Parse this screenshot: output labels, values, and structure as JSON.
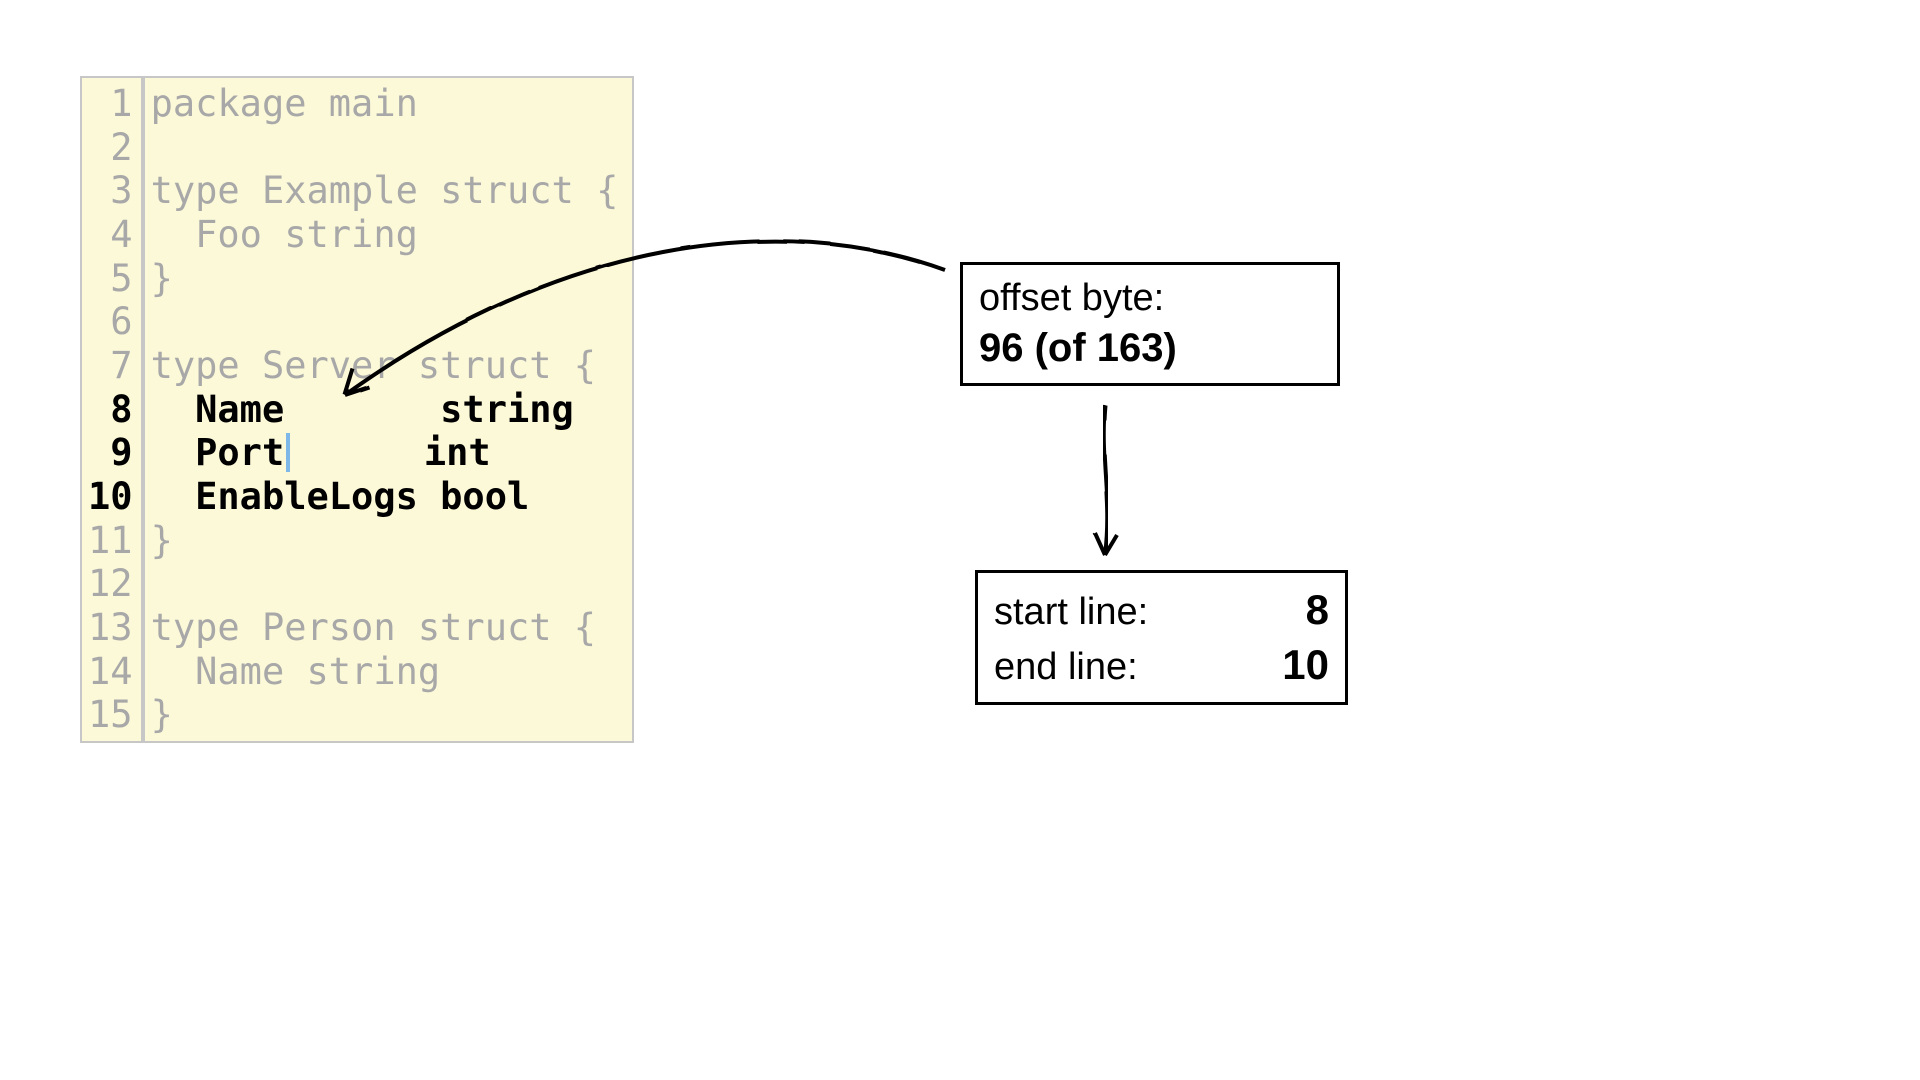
{
  "editor": {
    "bold_lines": [
      8,
      9,
      10
    ],
    "cursor": {
      "line": 9,
      "after_text": "  Port"
    },
    "lines": [
      {
        "n": 1,
        "text": "package main",
        "bold": false
      },
      {
        "n": 2,
        "text": "",
        "bold": false
      },
      {
        "n": 3,
        "text": "type Example struct {",
        "bold": false
      },
      {
        "n": 4,
        "text": "  Foo string",
        "bold": false
      },
      {
        "n": 5,
        "text": "}",
        "bold": false
      },
      {
        "n": 6,
        "text": "",
        "bold": false
      },
      {
        "n": 7,
        "text": "type Server struct {",
        "bold": false
      },
      {
        "n": 8,
        "text": "  Name       string",
        "bold": true
      },
      {
        "n": 9,
        "text": "  Port       int",
        "bold": true
      },
      {
        "n": 10,
        "text": "  EnableLogs bool",
        "bold": true
      },
      {
        "n": 11,
        "text": "}",
        "bold": false
      },
      {
        "n": 12,
        "text": "",
        "bold": false
      },
      {
        "n": 13,
        "text": "type Person struct {",
        "bold": false
      },
      {
        "n": 14,
        "text": "  Name string",
        "bold": false
      },
      {
        "n": 15,
        "text": "}",
        "bold": false
      }
    ]
  },
  "offset_box": {
    "label": "offset byte:",
    "value": "96 (of 163)"
  },
  "lines_box": {
    "start_label": "start line:",
    "start_value": "8",
    "end_label": "end line:",
    "end_value": "10"
  }
}
